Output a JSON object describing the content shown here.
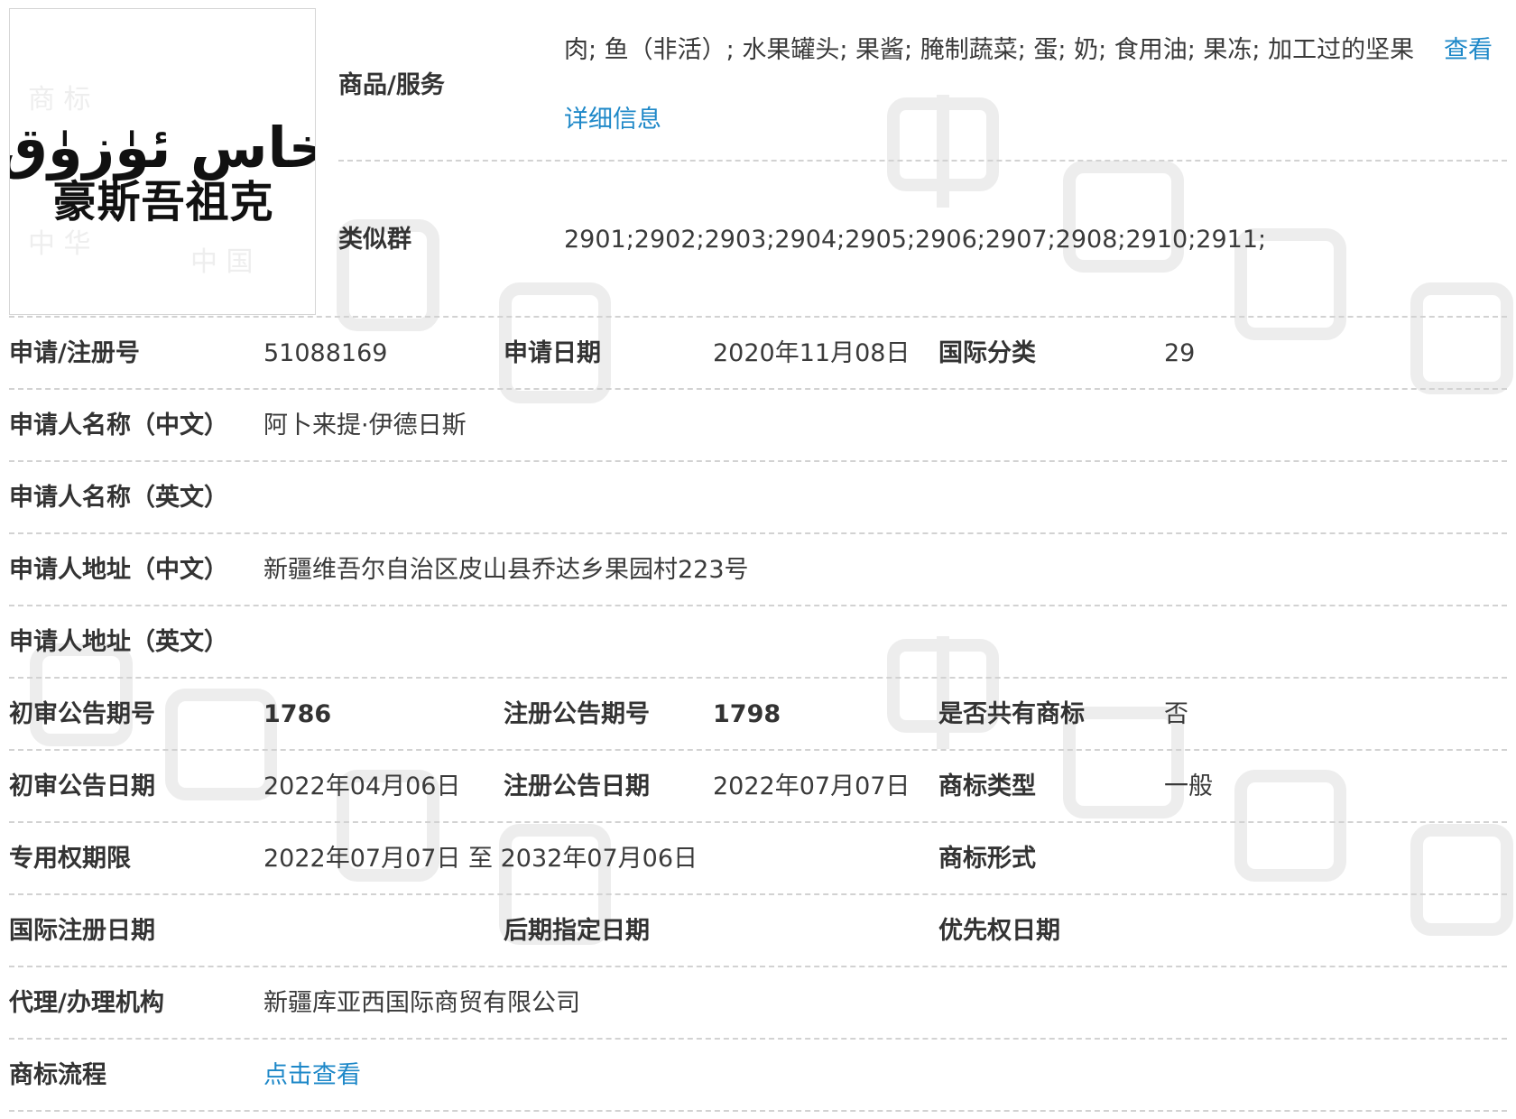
{
  "colors": {
    "label": "#333333",
    "value": "#3a3a3a",
    "link": "#1e88c8",
    "divider": "#d2d2d2",
    "watermark": "#ececec"
  },
  "logo": {
    "uyghur_text": "خاس ئۈزۈق",
    "chinese_text": "豪斯吾祖克"
  },
  "goods": {
    "label": "商品/服务",
    "value": "肉; 鱼（非活）; 水果罐头; 果酱; 腌制蔬菜; 蛋; 奶; 食用油; 果冻; 加工过的坚果",
    "view_link": "查看",
    "detail_link": "详细信息"
  },
  "similar_group": {
    "label": "类似群",
    "value": "2901;2902;2903;2904;2905;2906;2907;2908;2910;2911;"
  },
  "rows": {
    "reg_no_label": "申请/注册号",
    "reg_no": "51088169",
    "apply_date_label": "申请日期",
    "apply_date": "2020年11月08日",
    "intl_class_label": "国际分类",
    "intl_class": "29",
    "applicant_cn_label": "申请人名称（中文）",
    "applicant_cn": "阿卜来提·伊德日斯",
    "applicant_en_label": "申请人名称（英文）",
    "applicant_en": "",
    "address_cn_label": "申请人地址（中文）",
    "address_cn": "新疆维吾尔自治区皮山县乔达乡果园村223号",
    "address_en_label": "申请人地址（英文）",
    "address_en": "",
    "prelim_issue_label": "初审公告期号",
    "prelim_issue": "1786",
    "reg_issue_label": "注册公告期号",
    "reg_issue": "1798",
    "shared_label": "是否共有商标",
    "shared": "否",
    "prelim_date_label": "初审公告日期",
    "prelim_date": "2022年04月06日",
    "reg_date_label": "注册公告日期",
    "reg_date": "2022年07月07日",
    "tm_type_label": "商标类型",
    "tm_type": "一般",
    "exclusive_label": "专用权期限",
    "exclusive": "2022年07月07日 至 2032年07月06日",
    "tm_form_label": "商标形式",
    "tm_form": "",
    "intl_reg_date_label": "国际注册日期",
    "intl_reg_date": "",
    "later_date_label": "后期指定日期",
    "later_date": "",
    "priority_date_label": "优先权日期",
    "priority_date": "",
    "agency_label": "代理/办理机构",
    "agency": "新疆库亚西国际商贸有限公司",
    "process_label": "商标流程",
    "process_link": "点击查看"
  }
}
